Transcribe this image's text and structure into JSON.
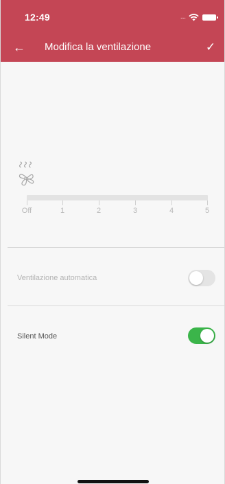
{
  "status_bar": {
    "time": "12:49",
    "signal": "....",
    "icons": [
      "wifi-icon",
      "battery-icon"
    ]
  },
  "header": {
    "title": "Modifica la ventilazione",
    "back_icon": "←",
    "confirm_icon": "✓",
    "background": "#c44655"
  },
  "fan": {
    "icon": "fan-icon",
    "slider_labels": [
      "Off",
      "1",
      "2",
      "3",
      "4",
      "5"
    ],
    "selected_level": "Off"
  },
  "settings": [
    {
      "label": "Ventilazione automatica",
      "enabled": false,
      "toggle_on": false
    },
    {
      "label": "Silent Mode",
      "enabled": true,
      "toggle_on": true
    }
  ],
  "colors": {
    "accent": "#c44655",
    "toggle_on": "#3bb54a",
    "toggle_off": "#e4e4e4"
  }
}
